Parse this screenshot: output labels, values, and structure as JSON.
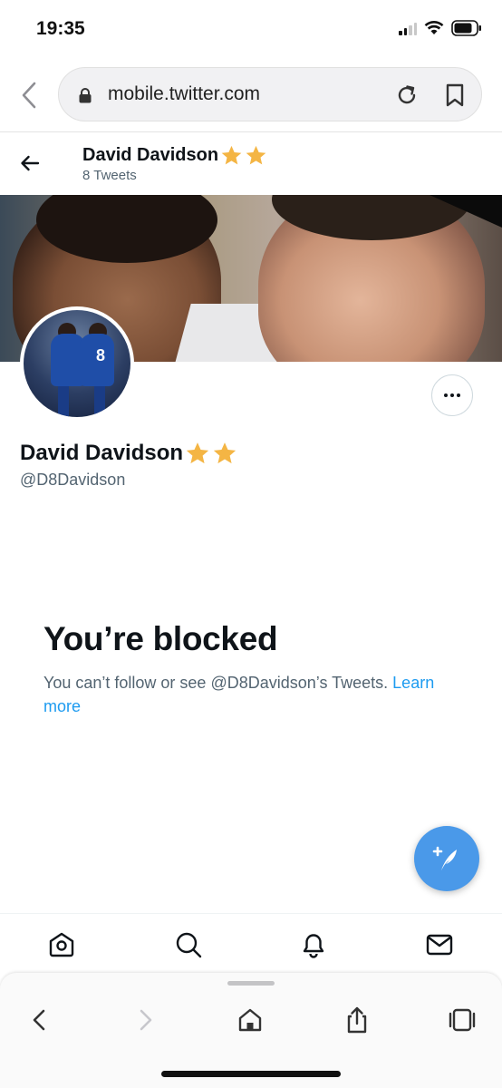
{
  "status_bar": {
    "time": "19:35"
  },
  "browser": {
    "url": "mobile.twitter.com"
  },
  "header": {
    "name": "David Davidson",
    "tweet_count": "8 Tweets"
  },
  "profile": {
    "name": "David Davidson",
    "handle": "@D8Davidson",
    "star_emoji": "⭐⭐",
    "avatar_jersey_number": "8"
  },
  "blocked": {
    "title": "You’re blocked",
    "message": "You can’t follow or see @D8Davidson’s Tweets.",
    "link": "Learn more"
  },
  "colors": {
    "accent": "#1d9bf0",
    "fab": "#4a99e9",
    "star": "#f4b544",
    "text_secondary": "#536471"
  },
  "icons": {
    "browser": [
      "back-icon",
      "lock-icon",
      "reload-icon",
      "bookmark-icon"
    ],
    "twitter_nav": [
      "home-icon",
      "search-icon",
      "notifications-icon",
      "messages-icon"
    ],
    "safari_toolbar": [
      "back-icon",
      "forward-icon",
      "home-icon",
      "share-icon",
      "tabs-icon"
    ]
  }
}
